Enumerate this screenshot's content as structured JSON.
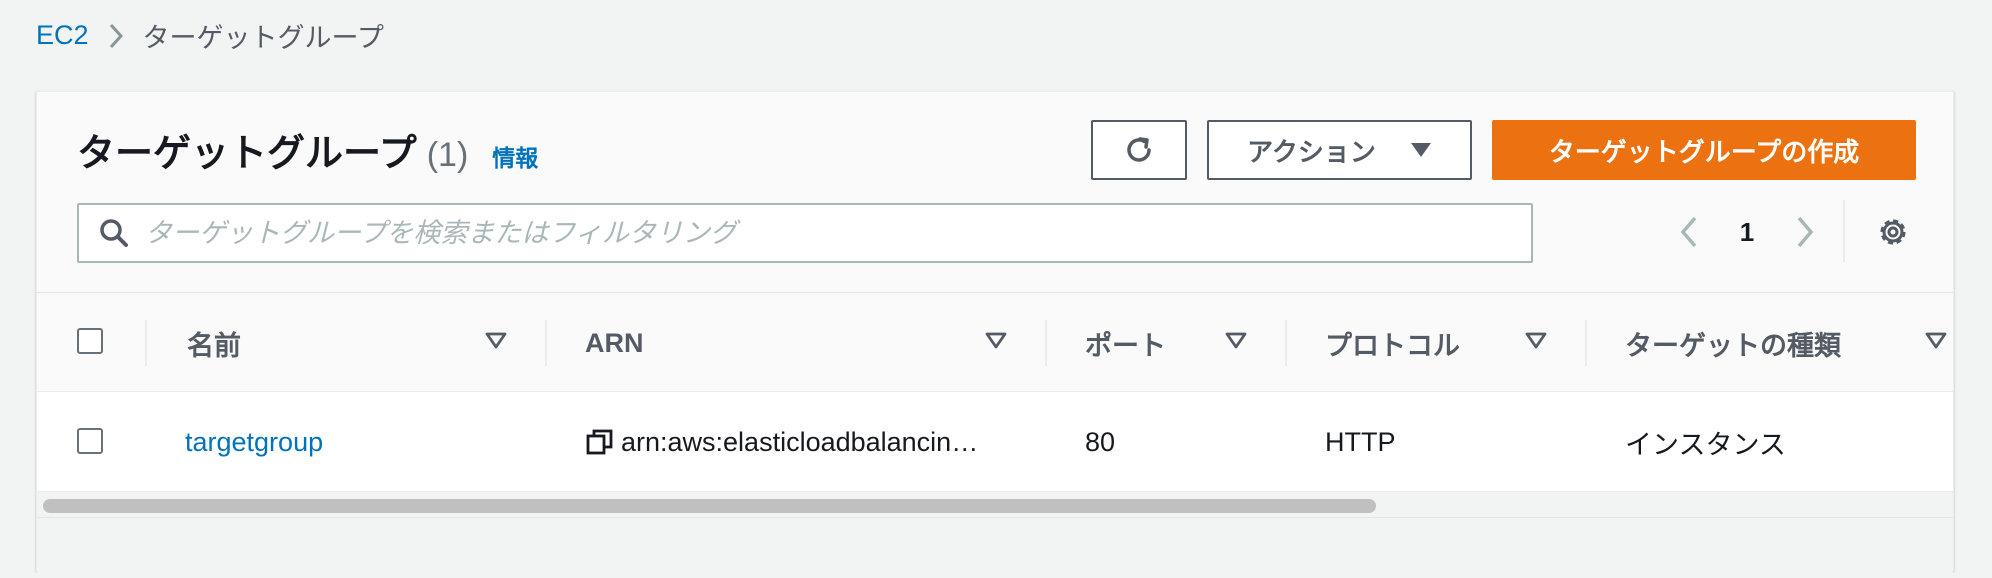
{
  "breadcrumb": {
    "root": "EC2",
    "current": "ターゲットグループ"
  },
  "header": {
    "title": "ターゲットグループ",
    "count": "(1)",
    "info_link": "情報"
  },
  "toolbar": {
    "refresh_icon": "refresh-icon",
    "actions_label": "アクション",
    "create_label": "ターゲットグループの作成"
  },
  "search": {
    "placeholder": "ターゲットグループを検索またはフィルタリング",
    "value": ""
  },
  "pagination": {
    "current_page": "1"
  },
  "table": {
    "columns": [
      {
        "label": "名前"
      },
      {
        "label": "ARN"
      },
      {
        "label": "ポート"
      },
      {
        "label": "プロトコル"
      },
      {
        "label": "ターゲットの種類"
      }
    ],
    "rows": [
      {
        "name": "targetgroup",
        "arn": "arn:aws:elasticloadbalancin…",
        "port": "80",
        "protocol": "HTTP",
        "target_type": "インスタンス"
      }
    ]
  },
  "colors": {
    "link": "#0073bb",
    "primary": "#ec7211",
    "text": "#16191f",
    "muted": "#545b64",
    "background": "#f2f3f3"
  }
}
